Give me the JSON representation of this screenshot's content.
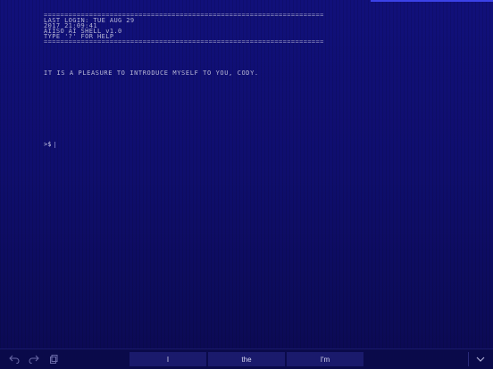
{
  "terminal": {
    "rule": "====================================================================",
    "login_line": "LAST LOGIN: TUE AUG 29",
    "address_line": "2017 21:09:41",
    "shell_line": "AIISO AI SHELL v1.0",
    "help_line": "TYPE '?' FOR HELP",
    "greeting": "IT IS A PLEASURE TO INTRODUCE MYSELF TO YOU, CODY.",
    "prompt": ">$"
  },
  "keyboard": {
    "suggestions": [
      "I",
      "the",
      "I'm"
    ],
    "icons": {
      "undo": "undo-icon",
      "redo": "redo-icon",
      "paste": "clipboard-icon",
      "dismiss": "chevron-down-icon"
    }
  },
  "colors": {
    "background": "#0f0e6e",
    "text": "#b7b7d6",
    "accent": "#3b42e8"
  }
}
